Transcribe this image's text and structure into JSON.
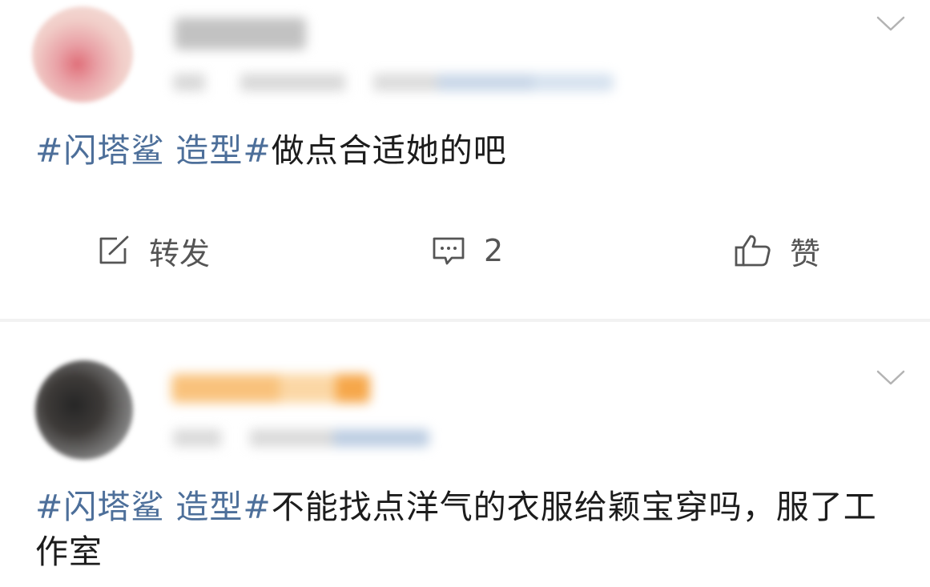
{
  "posts": [
    {
      "hashtag": "#闪塔鲨 造型#",
      "body": "做点合适她的吧",
      "actions": {
        "repost": "转发",
        "comment_count": "2",
        "like": "赞"
      }
    },
    {
      "hashtag": "#闪塔鲨 造型#",
      "body": "不能找点洋气的衣服给颖宝穿吗，服了工作室"
    }
  ],
  "icons": [
    "repost-icon",
    "comment-icon",
    "like-icon",
    "chevron-down-icon"
  ],
  "colors": {
    "hashtag": "#4d6f9a",
    "text": "#1c1c1c",
    "action": "#555555",
    "divider": "#f2f2f2"
  }
}
